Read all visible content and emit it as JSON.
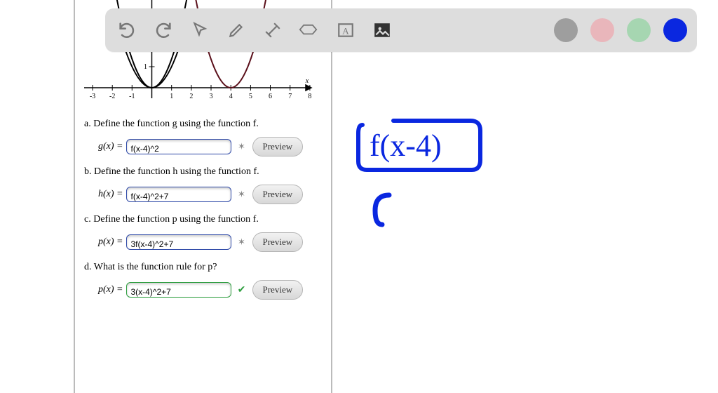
{
  "toolbar": {
    "icons": [
      "undo",
      "redo",
      "pointer",
      "pencil",
      "tools",
      "eraser",
      "textbox",
      "image"
    ],
    "colors": [
      "gray",
      "pink",
      "mint",
      "blue"
    ]
  },
  "chart_data": {
    "type": "line",
    "title": "",
    "xlabel": "x",
    "ylabel": "",
    "xlim": [
      -3.5,
      8.5
    ],
    "ylim": [
      -1,
      3.5
    ],
    "xticks": [
      -3,
      -2,
      -1,
      0,
      1,
      2,
      3,
      4,
      5,
      6,
      7,
      8
    ],
    "series": [
      {
        "name": "f(x)=x^2",
        "color": "#000",
        "type": "parabola",
        "vertex": [
          0,
          0
        ],
        "a": 1
      },
      {
        "name": "g(x)=(x-4)^2",
        "color": "#5a0f1a",
        "type": "parabola",
        "vertex": [
          4,
          0
        ],
        "a": 1
      }
    ]
  },
  "questions": [
    {
      "letter": "a.",
      "prompt": "Define the function g using the function f.",
      "lhs": "g(x) =",
      "value": "f(x-4)^2",
      "status": "wrong"
    },
    {
      "letter": "b.",
      "prompt": "Define the function h using the function f.",
      "lhs": "h(x) =",
      "value": "f(x-4)^2+7",
      "status": "wrong"
    },
    {
      "letter": "c.",
      "prompt": "Define the function p using the function f.",
      "lhs": "p(x) =",
      "value": "3f(x-4)^2+7",
      "status": "wrong"
    },
    {
      "letter": "d.",
      "prompt": "What is the function rule for p?",
      "lhs": "p(x) =",
      "value": "3(x-4)^2+7",
      "status": "ok"
    }
  ],
  "preview_label": "Preview",
  "handwriting": {
    "main": "f(x-4)",
    "stroke": "C"
  }
}
